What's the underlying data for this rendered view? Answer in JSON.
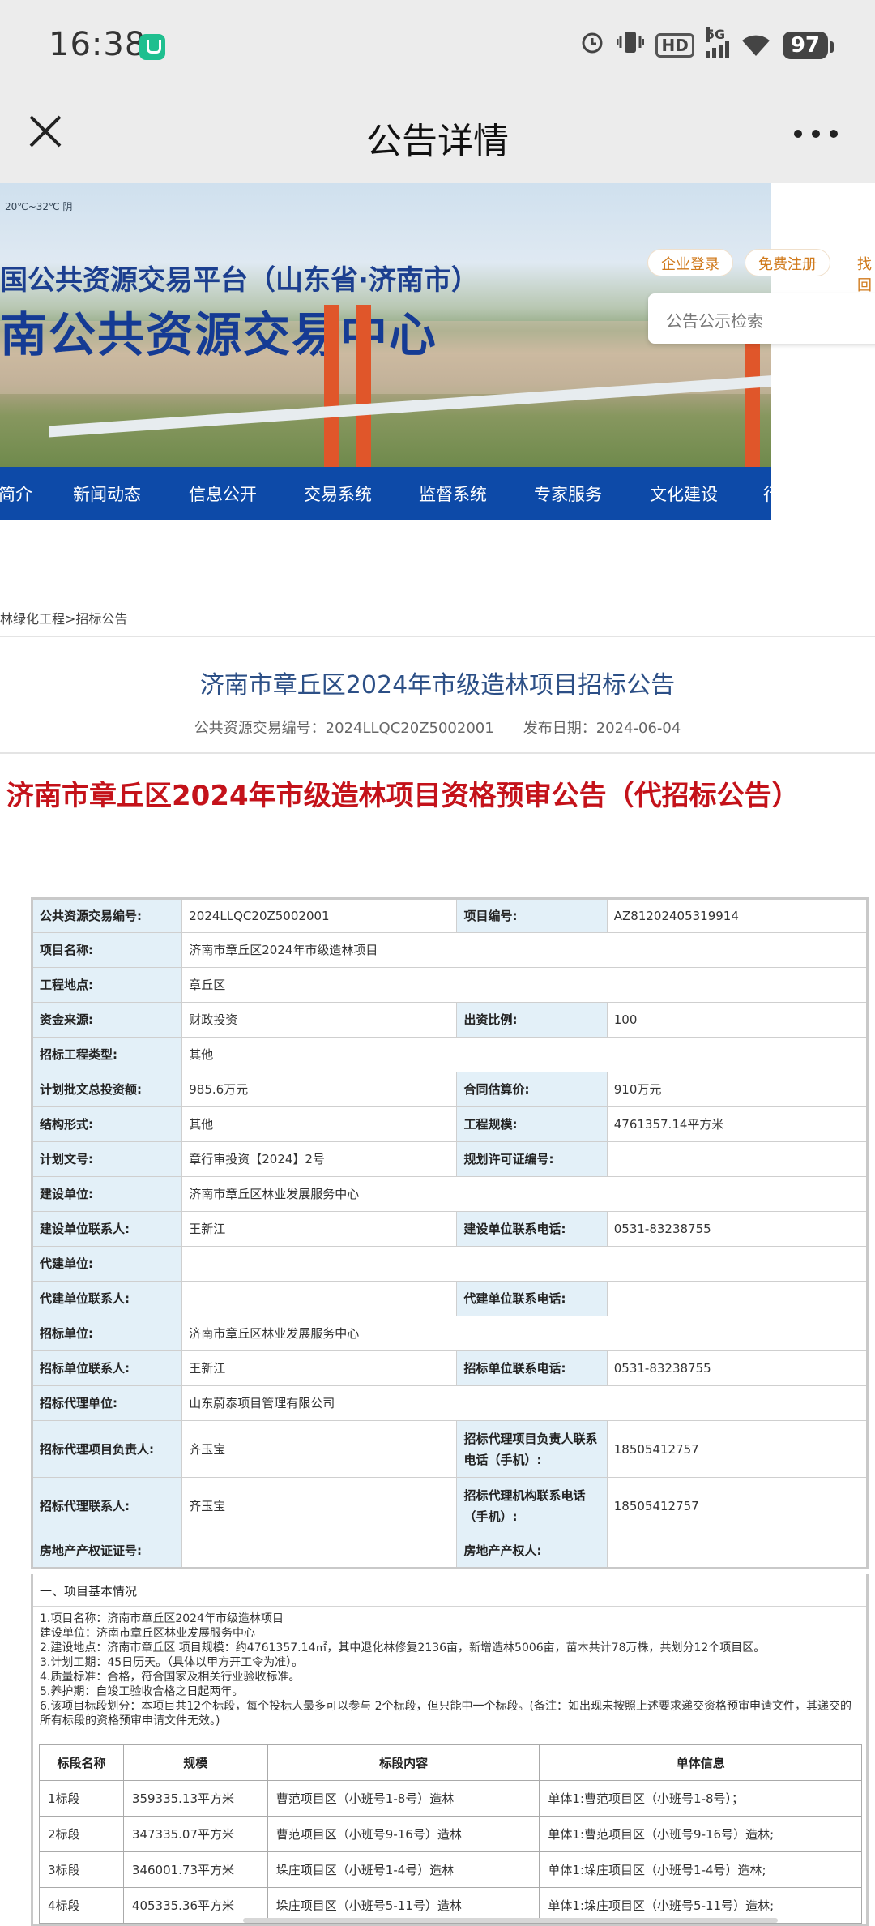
{
  "status_bar": {
    "time": "16:38",
    "icons": [
      "alarm-icon",
      "vibrate-icon",
      "hd-icon",
      "signal-5g-icon",
      "wifi-icon"
    ],
    "hd_label": "HD",
    "network_label": "5G",
    "battery": "97"
  },
  "title_bar": {
    "title": "公告详情"
  },
  "banner": {
    "weather": "20℃~32℃ 阴",
    "line1": "国公共资源交易平台（山东省·济南市）",
    "line2": "南公共资源交易中心",
    "login_label": "企业登录",
    "register_label": "免费注册",
    "find_label": "找回",
    "search_placeholder": "公告公示检索"
  },
  "nav": {
    "items": [
      "简介",
      "新闻动态",
      "信息公开",
      "交易系统",
      "监督系统",
      "专家服务",
      "文化建设",
      "行"
    ]
  },
  "breadcrumb": "林绿化工程>招标公告",
  "notice": {
    "title": "济南市章丘区2024年市级造林项目招标公告",
    "meta": "公共资源交易编号：2024LLQC20Z5002001　　发布日期：2024-06-04",
    "headline": "济南市章丘区2024年市级造林项目资格预审公告（代招标公告）"
  },
  "info_table": {
    "rows": [
      {
        "k1": "公共资源交易编号:",
        "v1": "2024LLQC20Z5002001",
        "k2": "项目编号:",
        "v2": "AZ81202405319914"
      },
      {
        "k1": "项目名称:",
        "v1": "济南市章丘区2024年市级造林项目"
      },
      {
        "k1": "工程地点:",
        "v1": "章丘区"
      },
      {
        "k1": "资金来源:",
        "v1": "财政投资",
        "k2": "出资比例:",
        "v2": "100"
      },
      {
        "k1": "招标工程类型:",
        "v1": "其他"
      },
      {
        "k1": "计划批文总投资额:",
        "v1": "985.6万元",
        "k2": "合同估算价:",
        "v2": "910万元"
      },
      {
        "k1": "结构形式:",
        "v1": "其他",
        "k2": "工程规模:",
        "v2": "4761357.14平方米"
      },
      {
        "k1": "计划文号:",
        "v1": "章行审投资【2024】2号",
        "k2": "规划许可证编号:",
        "v2": ""
      },
      {
        "k1": "建设单位:",
        "v1": "济南市章丘区林业发展服务中心"
      },
      {
        "k1": "建设单位联系人:",
        "v1": "王新江",
        "k2": "建设单位联系电话:",
        "v2": "0531-83238755"
      },
      {
        "k1": "代建单位:",
        "v1": ""
      },
      {
        "k1": "代建单位联系人:",
        "v1": "",
        "k2": "代建单位联系电话:",
        "v2": ""
      },
      {
        "k1": "招标单位:",
        "v1": "济南市章丘区林业发展服务中心"
      },
      {
        "k1": "招标单位联系人:",
        "v1": "王新江",
        "k2": "招标单位联系电话:",
        "v2": "0531-83238755"
      },
      {
        "k1": "招标代理单位:",
        "v1": "山东蔚泰项目管理有限公司"
      },
      {
        "k1": "招标代理项目负责人:",
        "v1": "齐玉宝",
        "k2": "招标代理项目负责人联系电话（手机）:",
        "v2": "18505412757"
      },
      {
        "k1": "招标代理联系人:",
        "v1": "齐玉宝",
        "k2": "招标代理机构联系电话（手机）:",
        "v2": "18505412757"
      },
      {
        "k1": "房地产产权证证号:",
        "v1": "",
        "k2": "房地产产权人:",
        "v2": ""
      }
    ]
  },
  "basic_info": {
    "header": "一、项目基本情况",
    "lines": [
      "1.项目名称：济南市章丘区2024年市级造林项目",
      "建设单位：济南市章丘区林业发展服务中心",
      "2.建设地点：济南市章丘区 项目规模：约4761357.14㎡，其中退化林修复2136亩，新增造林5006亩，苗木共计78万株，共划分12个项目区。",
      "3.计划工期：45日历天。（具体以甲方开工令为准）。",
      "4.质量标准：合格，符合国家及相关行业验收标准。",
      "5.养护期：自竣工验收合格之日起两年。",
      "6.该项目标段划分：本项目共12个标段，每个投标人最多可以参与 2个标段，但只能中一个标段。(备注：如出现未按照上述要求递交资格预审申请文件，其递交的所有标段的资格预审申请文件无效。)"
    ]
  },
  "lot_table": {
    "headers": [
      "标段名称",
      "规模",
      "标段内容",
      "单体信息"
    ],
    "rows": [
      [
        "1标段",
        "359335.13平方米",
        "曹范项目区（小班号1-8号）造林",
        "单体1:曹范项目区（小班号1-8号）；"
      ],
      [
        "2标段",
        "347335.07平方米",
        "曹范项目区（小班号9-16号）造林",
        "单体1:曹范项目区（小班号9-16号）造林;"
      ],
      [
        "3标段",
        "346001.73平方米",
        "垛庄项目区（小班号1-4号）造林",
        "单体1:垛庄项目区（小班号1-4号）造林;"
      ],
      [
        "4标段",
        "405335.36平方米",
        "垛庄项目区（小班号5-11号）造林",
        "单体1:垛庄项目区（小班号5-11号）造林;"
      ]
    ]
  }
}
